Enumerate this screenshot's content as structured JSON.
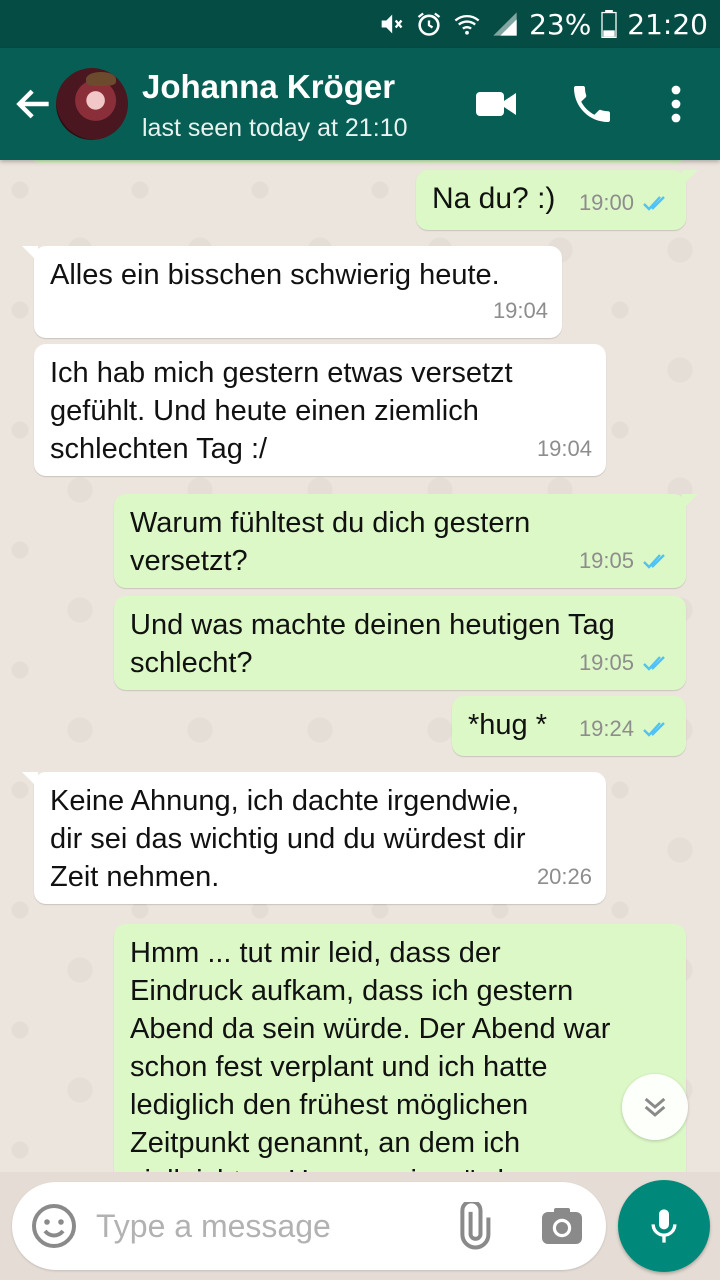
{
  "status_bar": {
    "battery": "23%",
    "time": "21:20"
  },
  "header": {
    "contact_name": "Johanna Kröger",
    "contact_status": "last seen today at 21:10"
  },
  "messages": [
    {
      "dir": "out",
      "text": "Na du? :)",
      "time": "19:00",
      "read": true
    },
    {
      "dir": "in",
      "text": "Alles ein bisschen schwierig heute.",
      "time": "19:04"
    },
    {
      "dir": "in",
      "text": "Ich hab mich gestern etwas versetzt\ngefühlt. Und heute einen ziemlich\nschlechten Tag :/",
      "time": "19:04"
    },
    {
      "dir": "out",
      "text": "Warum fühltest du dich gestern\nversetzt?",
      "time": "19:05",
      "read": true
    },
    {
      "dir": "out",
      "text": "Und was machte deinen heutigen Tag\nschlecht?",
      "time": "19:05",
      "read": true
    },
    {
      "dir": "out",
      "text": "*hug *",
      "time": "19:24",
      "read": true
    },
    {
      "dir": "in",
      "text": "Keine Ahnung, ich dachte irgendwie,\ndir sei das wichtig und du würdest dir\nZeit nehmen.",
      "time": "20:26"
    },
    {
      "dir": "out",
      "text": "Hmm ... tut mir leid, dass der\nEindruck aufkam, dass ich gestern\nAbend da sein würde. Der Abend war\nschon fest verplant und ich hatte\nlediglich den frühest möglichen\nZeitpunkt genannt, an dem ich\nvielleicht zu Hause sein würde.",
      "time": ""
    }
  ],
  "composer": {
    "placeholder": "Type a message"
  },
  "icons": {
    "back": "arrow-left-icon",
    "video": "video-call-icon",
    "call": "phone-icon",
    "menu": "more-vert-icon",
    "emoji": "emoji-icon",
    "attach": "paperclip-icon",
    "camera": "camera-icon",
    "mic": "mic-icon",
    "scroll": "chevron-double-down-icon"
  },
  "colors": {
    "header": "#075e54",
    "statusbar": "#054d44",
    "outgoing": "#dcf8c6",
    "incoming": "#ffffff",
    "read_ticks": "#4fc3f7",
    "fab": "#00897b"
  }
}
